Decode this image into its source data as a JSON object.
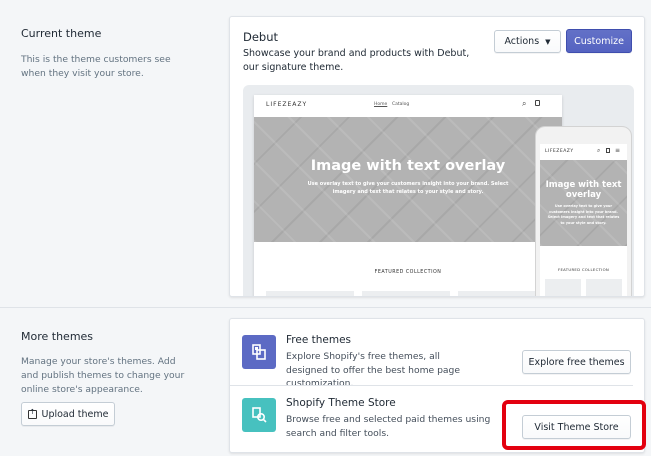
{
  "current_theme": {
    "heading": "Current theme",
    "description": "This is the theme customers see when they visit your store.",
    "theme_name": "Debut",
    "theme_description": "Showcase your brand and products with Debut, our signature theme.",
    "actions_label": "Actions",
    "customize_label": "Customize",
    "preview": {
      "logo": "LIFEZEAZY",
      "nav_home": "Home",
      "nav_catalog": "Catalog",
      "hero_title": "Image with text overlay",
      "hero_sub": "Use overlay text to give your customers insight into your brand. Select imagery and text that relates to your style and story.",
      "featured": "FEATURED COLLECTION",
      "phone_logo": "LIFEZEAZY",
      "phone_hero_title": "Image with text overlay",
      "phone_hero_sub": "Use overlay text to give your customers insight into your brand. Select imagery and text that relates to your style and story.",
      "phone_featured": "FEATURED COLLECTION"
    }
  },
  "more_themes": {
    "heading": "More themes",
    "description": "Manage your store's themes. Add and publish themes to change your online store's appearance.",
    "upload_label": "Upload theme",
    "free": {
      "title": "Free themes",
      "description": "Explore Shopify's free themes, all designed to offer the best home page customization.",
      "button": "Explore free themes",
      "icon_color": "#5c6ac4"
    },
    "store": {
      "title": "Shopify Theme Store",
      "description": "Browse free and selected paid themes using search and filter tools.",
      "button": "Visit Theme Store",
      "icon_color": "#47c1bf"
    }
  },
  "colors": {
    "background": "#f4f6f8",
    "primary": "#5c6ac4",
    "highlight": "#e3000f"
  }
}
